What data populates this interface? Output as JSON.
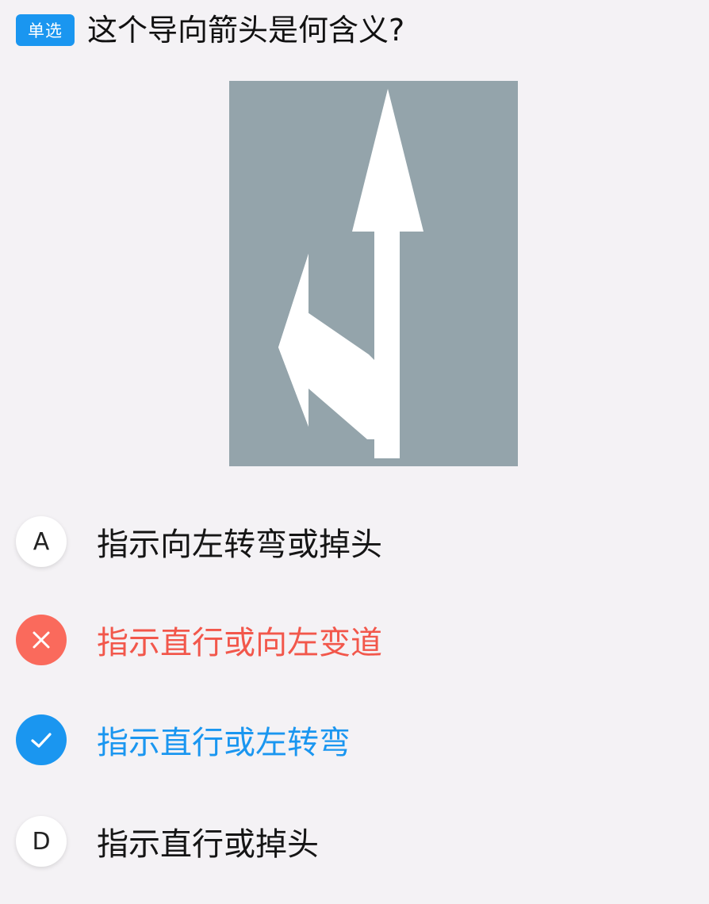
{
  "question": {
    "type_badge": "单选",
    "text": "这个导向箭头是何含义?"
  },
  "figure": {
    "background_color": "#94a4ab",
    "arrow_color": "#ffffff"
  },
  "options": [
    {
      "marker": "A",
      "text": "指示向左转弯或掉头",
      "state": "unselected"
    },
    {
      "marker": "x-icon",
      "text": "指示直行或向左变道",
      "state": "wrong"
    },
    {
      "marker": "check-icon",
      "text": "指示直行或左转弯",
      "state": "correct"
    },
    {
      "marker": "D",
      "text": "指示直行或掉头",
      "state": "unselected"
    }
  ],
  "colors": {
    "accent": "#1a96f0",
    "wrong": "#f2574b",
    "background": "#f4f2f5"
  }
}
